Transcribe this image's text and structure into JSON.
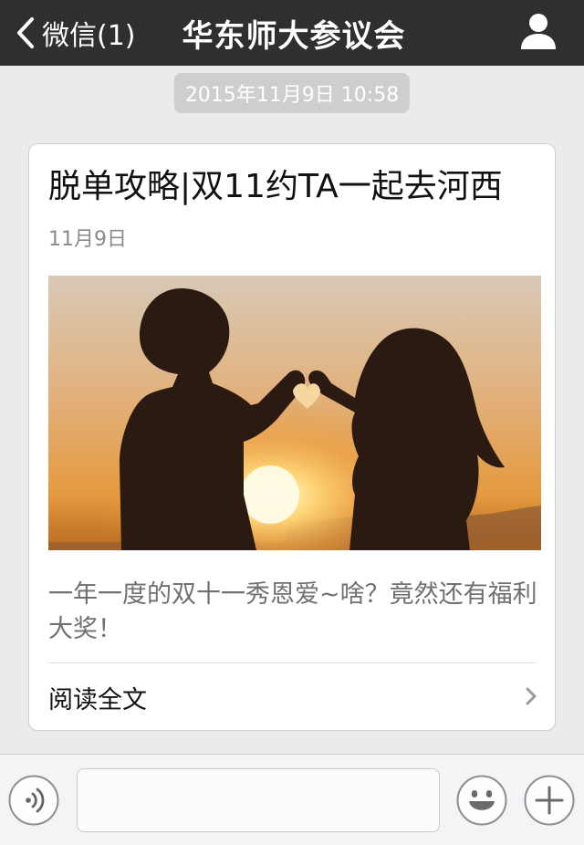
{
  "header": {
    "back_label": "微信(1)",
    "title": "华东师大参议会",
    "back_icon": "chevron-left-icon",
    "profile_icon": "person-icon"
  },
  "timestamp": "2015年11月9日 10:58",
  "article": {
    "title": "脱单攻略|双11约TA一起去河西",
    "date": "11月9日",
    "cover_alt": "sunset-silhouette-couple-heart",
    "summary": "一年一度的双十一秀恩爱~啥？竟然还有福利大奖！",
    "read_more_label": "阅读全文"
  },
  "input_bar": {
    "voice_icon": "voice-icon",
    "input_value": "",
    "emoji_icon": "smiley-icon",
    "more_icon": "plus-icon"
  },
  "colors": {
    "header_bg": "#2f2f31",
    "page_bg": "#ebebeb",
    "card_bg": "#ffffff",
    "timestamp_bg": "#cecece"
  }
}
